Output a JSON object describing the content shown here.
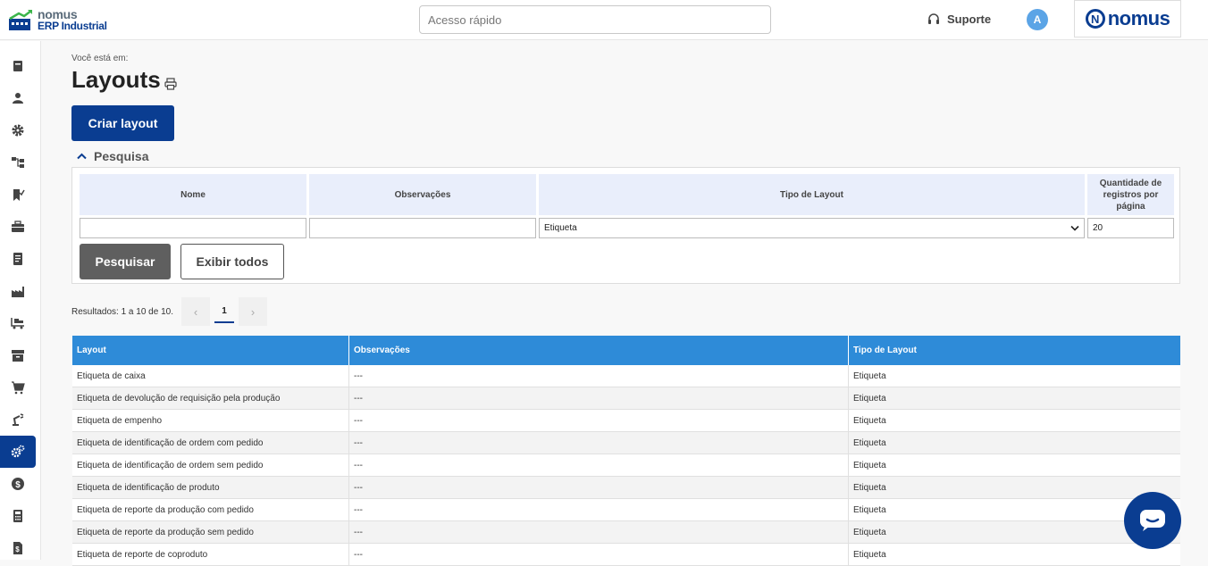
{
  "header": {
    "logo_line1": "nomus",
    "logo_line2": "ERP Industrial",
    "quick_access_placeholder": "Acesso rápido",
    "support_label": "Suporte",
    "avatar_initial": "A",
    "brand_label": "nomus",
    "brand_initial": "N"
  },
  "sidebar": {
    "items": [
      {
        "icon": "book-icon"
      },
      {
        "icon": "person-icon"
      },
      {
        "icon": "gear-icon"
      },
      {
        "icon": "flow-icon"
      },
      {
        "icon": "bookmark-check-icon"
      },
      {
        "icon": "briefcase-icon"
      },
      {
        "icon": "document-icon"
      },
      {
        "icon": "factory-icon"
      },
      {
        "icon": "pallet-icon"
      },
      {
        "icon": "archive-icon"
      },
      {
        "icon": "cart-icon"
      },
      {
        "icon": "robot-arm-icon"
      },
      {
        "icon": "gears-icon",
        "active": true
      },
      {
        "icon": "dollar-icon"
      },
      {
        "icon": "calculator-icon"
      },
      {
        "icon": "invoice-icon"
      }
    ]
  },
  "page": {
    "breadcrumb": "Você está em:",
    "title": "Layouts",
    "create_button": "Criar layout"
  },
  "search": {
    "section_label": "Pesquisa",
    "columns": {
      "name": "Nome",
      "observations": "Observações",
      "layout_type": "Tipo de Layout",
      "records_per_page": "Quantidade de registros por página"
    },
    "fields": {
      "name": "",
      "observations": "",
      "layout_type": "Etiqueta",
      "records_per_page": "20"
    },
    "search_button": "Pesquisar",
    "show_all_button": "Exibir todos"
  },
  "pagination": {
    "results_text": "Resultados: 1 a 10 de 10.",
    "prev": "‹",
    "current_page": "1",
    "next": "›"
  },
  "table": {
    "columns": [
      "Layout",
      "Observações",
      "Tipo de Layout"
    ],
    "rows": [
      [
        "Etiqueta de caixa",
        "---",
        "Etiqueta"
      ],
      [
        "Etiqueta de devolução de requisição pela produção",
        "---",
        "Etiqueta"
      ],
      [
        "Etiqueta de empenho",
        "---",
        "Etiqueta"
      ],
      [
        "Etiqueta de identificação de ordem com pedido",
        "---",
        "Etiqueta"
      ],
      [
        "Etiqueta de identificação de ordem sem pedido",
        "---",
        "Etiqueta"
      ],
      [
        "Etiqueta de identificação de produto",
        "---",
        "Etiqueta"
      ],
      [
        "Etiqueta de reporte da produção com pedido",
        "---",
        "Etiqueta"
      ],
      [
        "Etiqueta de reporte da produção sem pedido",
        "---",
        "Etiqueta"
      ],
      [
        "Etiqueta de reporte de coproduto",
        "---",
        "Etiqueta"
      ]
    ]
  },
  "colors": {
    "primary": "#0a3d91",
    "table_header": "#2e8bd8",
    "avatar": "#5ba4e6"
  }
}
